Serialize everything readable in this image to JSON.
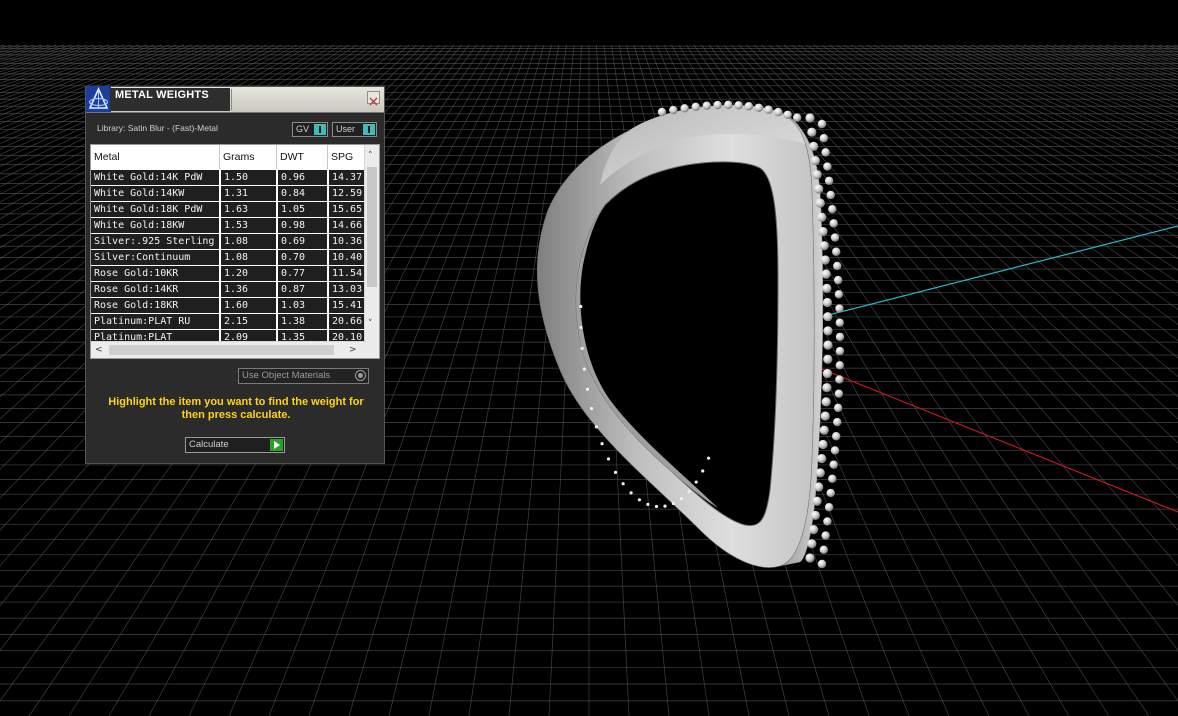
{
  "viewport": {
    "grid_line_color": "#5a5a5a",
    "axis_x_color": "#c41b1b",
    "axis_y_color": "#2fb5c4",
    "ring_color": "#c8c8c8"
  },
  "panel": {
    "title": "METAL WEIGHTS",
    "app_icon": "matrix-logo-icon",
    "close_icon": "close-icon",
    "library_label": "Library: Satin Blur - (Fast)-Metal",
    "gv_dropdown": "GV",
    "user_dropdown": "User",
    "table": {
      "columns": [
        "Metal",
        "Grams",
        "DWT",
        "SPG"
      ],
      "rows": [
        [
          "White Gold:14K PdW",
          "1.50",
          "0.96",
          "14.37"
        ],
        [
          "White Gold:14KW",
          "1.31",
          "0.84",
          "12.59"
        ],
        [
          "White Gold:18K PdW",
          "1.63",
          "1.05",
          "15.65"
        ],
        [
          "White Gold:18KW",
          "1.53",
          "0.98",
          "14.66"
        ],
        [
          "Silver:.925 Sterling",
          "1.08",
          "0.69",
          "10.36"
        ],
        [
          "Silver:Continuum",
          "1.08",
          "0.70",
          "10.40"
        ],
        [
          "Rose Gold:10KR",
          "1.20",
          "0.77",
          "11.54"
        ],
        [
          "Rose Gold:14KR",
          "1.36",
          "0.87",
          "13.03"
        ],
        [
          "Rose Gold:18KR",
          "1.60",
          "1.03",
          "15.41"
        ],
        [
          "Platinum:PLAT RU",
          "2.15",
          "1.38",
          "20.66"
        ],
        [
          "Platinum:PLAT",
          "2.09",
          "1.35",
          "20.10"
        ]
      ]
    },
    "use_object_materials": "Use Object Materials",
    "instruction": "Highlight the item you want to find the weight for then press calculate.",
    "calculate_label": "Calculate",
    "highlight_color": "#ffd21a"
  }
}
